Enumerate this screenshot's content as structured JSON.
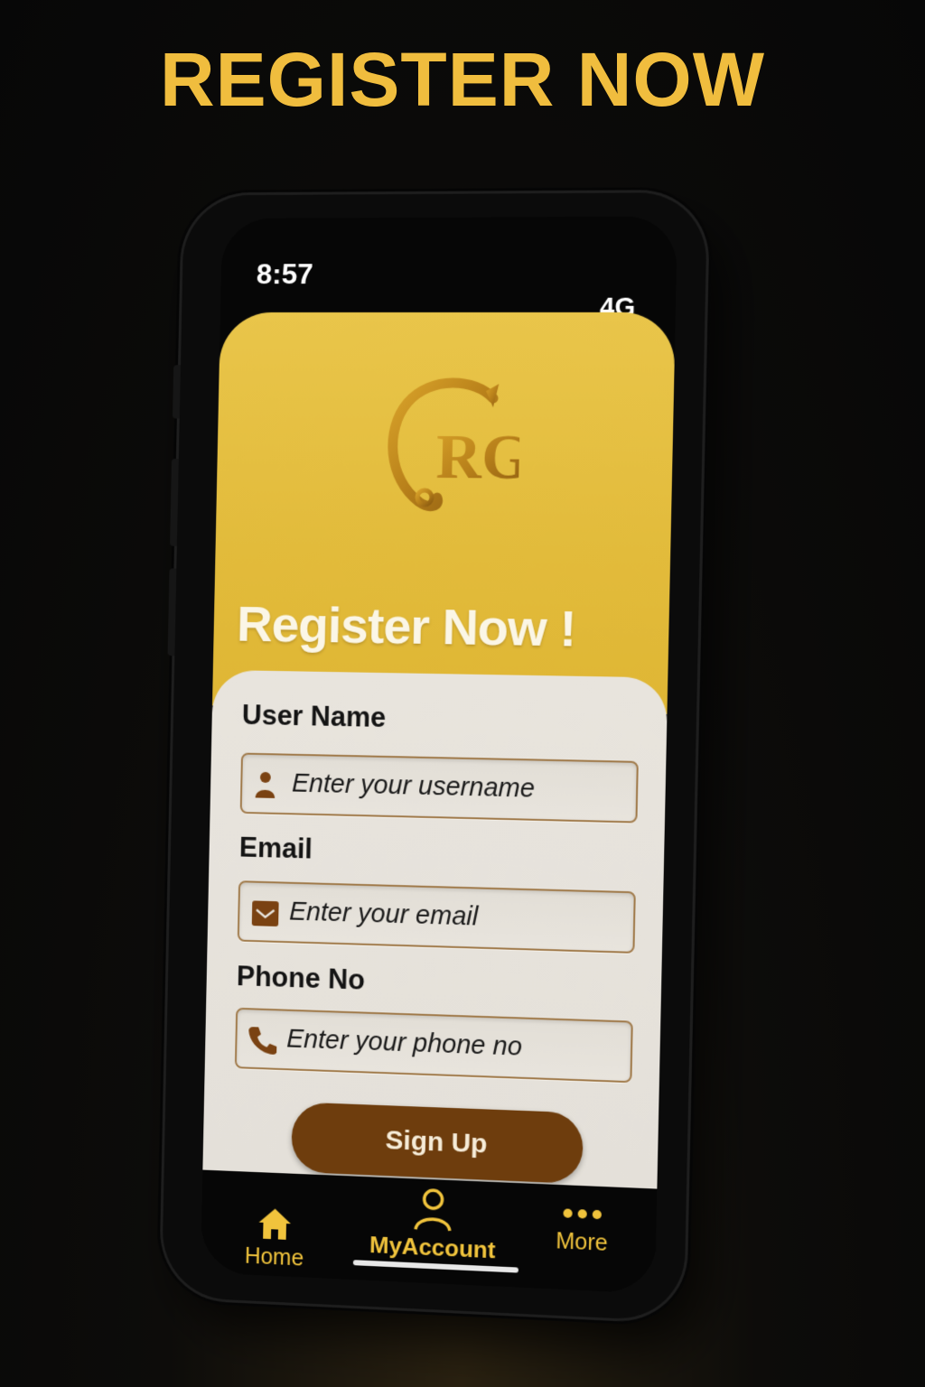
{
  "poster": {
    "title": "REGISTER NOW"
  },
  "status_bar": {
    "time": "8:57",
    "network": "4G"
  },
  "header": {
    "logo_text": "RG",
    "title": "Register Now !"
  },
  "form": {
    "username": {
      "label": "User Name",
      "placeholder": "Enter your username",
      "icon": "user-icon"
    },
    "email": {
      "label": "Email",
      "placeholder": "Enter your email",
      "icon": "mail-icon"
    },
    "phone": {
      "label": "Phone No",
      "placeholder": "Enter your phone no",
      "icon": "phone-icon"
    },
    "submit_label": "Sign Up"
  },
  "tabbar": {
    "items": [
      {
        "label": "Home",
        "icon": "home-icon",
        "active": false
      },
      {
        "label": "MyAccount",
        "icon": "account-icon",
        "active": true
      },
      {
        "label": "More",
        "icon": "more-icon",
        "active": false
      }
    ]
  },
  "colors": {
    "accent_gold": "#f0bd3e",
    "header_yellow": "#e2bb3b",
    "button_brown": "#6e3d0d",
    "card_bg": "#e6e2db"
  }
}
